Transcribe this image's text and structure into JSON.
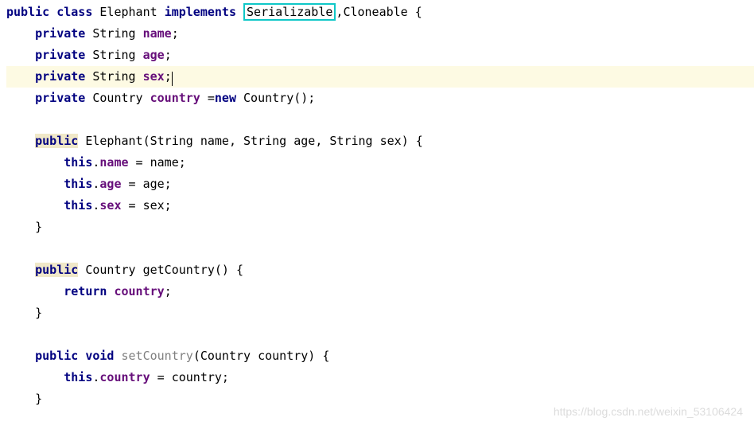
{
  "code": {
    "l1": {
      "kw_public": "public",
      "kw_class": "class",
      "class_name": "Elephant",
      "kw_implements": "implements",
      "iface1": "Serializable",
      "comma": ",",
      "iface2": "Cloneable",
      "brace": " {"
    },
    "l2": {
      "kw_private": "private",
      "type": "String",
      "name": "name",
      "semi": ";"
    },
    "l3": {
      "kw_private": "private",
      "type": "String",
      "name": "age",
      "semi": ";"
    },
    "l4": {
      "kw_private": "private",
      "type": "String",
      "name": "sex",
      "semi": ";"
    },
    "l5": {
      "kw_private": "private",
      "type": "Country",
      "name": "country",
      "eq": " =",
      "kw_new": "new",
      "ctor": " Country();"
    },
    "l7": {
      "kw_public": "public",
      "sig": " Elephant(String name, String age, String sex) {"
    },
    "l8": {
      "kw_this": "this",
      "dot": ".",
      "field": "name",
      "rest": " = name;"
    },
    "l9": {
      "kw_this": "this",
      "dot": ".",
      "field": "age",
      "rest": " = age;"
    },
    "l10": {
      "kw_this": "this",
      "dot": ".",
      "field": "sex",
      "rest": " = sex;"
    },
    "l11": {
      "brace": "}"
    },
    "l13": {
      "kw_public": "public",
      "sig": " Country getCountry() {"
    },
    "l14": {
      "kw_return": "return",
      "field": "country",
      "semi": ";"
    },
    "l15": {
      "brace": "}"
    },
    "l17a": {
      "kw_public": "public"
    },
    "l17b": {
      "kw_void": "void"
    },
    "l17c": {
      "method": "setCountry"
    },
    "l17d": {
      "rest": "(Country country) {"
    },
    "l18": {
      "kw_this": "this",
      "dot": ".",
      "field": "country",
      "rest": " = country;"
    },
    "l19": {
      "brace": "}"
    }
  },
  "watermark": "https://blog.csdn.net/weixin_53106424"
}
